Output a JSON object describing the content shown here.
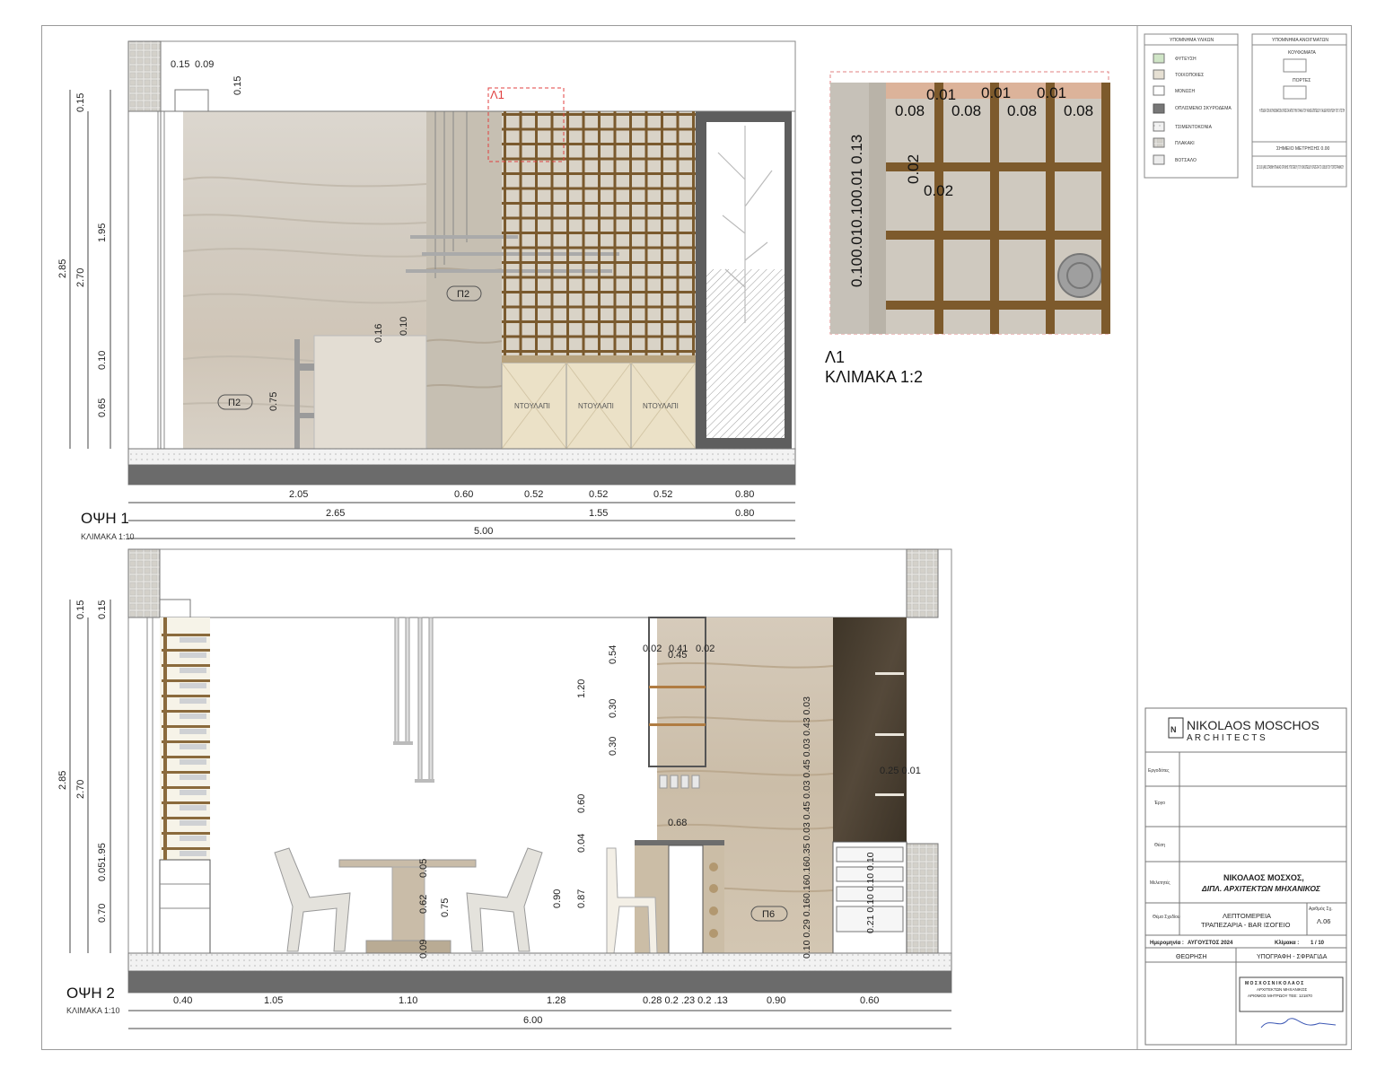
{
  "sheet": {
    "view1": {
      "title": "ΟΨΗ 1",
      "scale": "ΚΛΙΜΑΚΑ 1:10",
      "detail_tag": "Λ1",
      "heights": {
        "h_015": "0.15",
        "h_195": "1.95",
        "h_285": "2.85",
        "h_270": "2.70",
        "h_010": "0.10",
        "h_065": "0.65"
      },
      "top_dims": {
        "a": "0.15",
        "b": "0.09",
        "c": "0.15"
      },
      "inner": {
        "d016": "0.16",
        "d010": "0.10",
        "d075": "0.75"
      },
      "tags": {
        "p2a": "Π2",
        "p2b": "Π2"
      },
      "drawers": [
        "ΝΤΟΥΛΑΠΙ",
        "ΝΤΟΥΛΑΠΙ",
        "ΝΤΟΥΛΑΠΙ"
      ],
      "bottom_row1": [
        "2.05",
        "0.60",
        "0.52",
        "0.52",
        "0.52",
        "0.80"
      ],
      "bottom_row2": [
        "2.65",
        "1.55",
        "0.80"
      ],
      "bottom_row3": "5.00"
    },
    "detail": {
      "title": "Λ1",
      "scale": "ΚΛΙΜΑΚΑ 1:2",
      "top_small": [
        "0.01",
        "0.01",
        "0.01"
      ],
      "top_large": [
        "0.08",
        "0.08",
        "0.08",
        "0.08"
      ],
      "left_vertical": "0.100.010.100.01 0.13",
      "inner_v": "0.02",
      "inner_h": "0.02"
    },
    "view2": {
      "title": "ΟΨΗ 2",
      "scale": "ΚΛΙΜΑΚΑ 1:10",
      "heights": {
        "h015": "0.15",
        "h285": "2.85",
        "h270": "2.70",
        "h195": "0.051.95",
        "h070": "0.70"
      },
      "shelf_dims": {
        "w045": "0.45",
        "d002a": "0.02",
        "w041": "0.41",
        "d002b": "0.02",
        "v054": "0.54",
        "v030a": "0.30",
        "v030b": "0.30",
        "v120": "1.20",
        "v060": "0.60",
        "v004": "0.04",
        "v090": "0.90",
        "v087": "0.87",
        "w068": "0.68"
      },
      "table_dims": {
        "t005": "0.05",
        "t062": "0.62",
        "t075": "0.75",
        "t009": "0.09"
      },
      "right_vertical": "0.10 0.29 0.160.160.160.35 0.03 0.45 0.03 0.45 0.03 0.43 0.03",
      "right_vertical2": "0.21 0.10 0.10 0.10",
      "dark_dims": "0.25 0.01",
      "tag": "Π6",
      "bottom_row1": [
        "0.40",
        "1.05",
        "1.10",
        "1.28",
        "0.28 0.2 .23 0.2 .13",
        "0.90",
        "0.60"
      ],
      "bottom_row2": "6.00"
    },
    "legend_materials": {
      "title": "ΥΠΟΜΝΗΜΑ ΥΛΙΚΩΝ",
      "items": [
        "ΦΥΤΕΥΣΗ",
        "ΤΟΙΧΟΠΟΙΙΕΣ",
        "ΜΟΝΩΣΗ",
        "ΟΠΛΙΣΜΕΝΟ ΣΚΥΡΟΔΕΜΑ",
        "ΤΣΙΜΕΝΤΟΚΟΝΙΑ",
        "ΠΛΑΚΑΚΙ",
        "ΒΟΤΣΑΛΟ"
      ]
    },
    "legend_openings": {
      "title": "ΥΠΟΜΝΗΜΑ ΑΝΟΙΓΜΑΤΩΝ",
      "windows": "ΚΟΥΦΩΜΑΤΑ",
      "doors": "ΠΟΡΤΕΣ",
      "note1": "Η ΠΟΔΙΑ ΤΩΝ ΚΟΥΦΩΜΑΤΩΝ ΟΡΙΖΕΤΑΙ ΑΠΟ ΤΗΝ ΠΛΑΚΑ ΤΟΥ ΚΑΘΕ ΕΠΙΠΕΔΟΥ ΓΙΑ ΔΙΕΥΚΟΛΥΝΣΗ ΤΟΥ ΧΤΙΣΤΗ",
      "note2": "ΣΗΜΕΙΟ ΜΕΤΡΗΣΗΣ 0.00",
      "note3": "ΩΣ 0.00 (ΑΝΩ ΣΤΑΘΜΗ ΠΛΑΚΑΣ ΟΡΟΦΗΣ ΥΠΟΓΕΙΟΥ) ΤΟΥ ΟΙΚΟΠΕΔΟΥ ΟΡΙΖΕΤΑΙ ΤΟ 108.88 ΤΟΥ ΤΟΠΟΓΡΑΦΙΚΟΥ"
    },
    "title_block": {
      "firm_line1": "NIKOLAOS MOSCHOS",
      "firm_line2": "A R C H I T E C T S",
      "client_label": "Εργοδότες",
      "project_label": "Έργο",
      "location_label": "Θέση",
      "designers_label": "Μελετητές",
      "designer_name": "ΝΙΚΟΛΑΟΣ ΜΟΣΧΟΣ,",
      "designer_title": "ΔΙΠΛ. ΑΡΧΙΤΕΚΤΩΝ ΜΗΧΑΝΙΚΟΣ",
      "subject_label": "Θέμα Σχεδίου",
      "subject_line1": "ΛΕΠΤΟΜΕΡΕΙΑ",
      "subject_line2": "ΤΡΑΠΕΖΑΡΙΑ - BAR ΙΣΟΓΕΙΟ",
      "sheet_no_label": "Αριθμός Σχ.",
      "sheet_no": "Λ.06",
      "date_label": "Ημερομηνία :",
      "date_value": "ΑΥΓΟΥΣΤΟΣ 2024",
      "scale_label": "Κλίμακα :",
      "scale_value": "1 / 10",
      "review_label": "ΘΕΩΡΗΣΗ",
      "sign_label": "ΥΠΟΓΡΑΦΗ - ΣΦΡΑΓΙΔΑ",
      "stamp_line1": "Μ Ο Σ Χ Ο Σ   Ν Ι Κ Ο Λ Α Ο Σ",
      "stamp_line2": "ΑΡΧΙΤΕΚΤΩΝ ΜΗΧΑΝΙΚΟΣ",
      "stamp_line3": "ΑΡΙΘΜΟΣ ΜΗΤΡΩΟΥ ΤΕΕ: 121870"
    }
  }
}
